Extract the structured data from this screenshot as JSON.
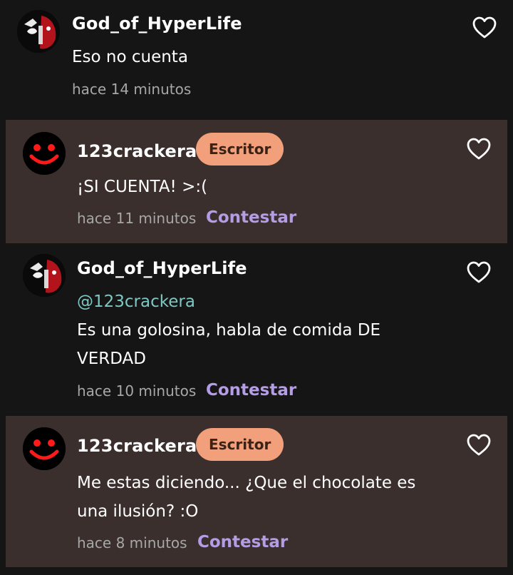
{
  "comments": [
    {
      "author": "God_of_HyperLife",
      "text": "Eso no cuenta",
      "time": "hace 14 minutos",
      "like_icon": "heart-outline-icon",
      "avatar_icon": "avatar-hyperlife"
    },
    {
      "author": "123crackera",
      "badge": "Escritor",
      "text": "¡SI CUENTA! >:(",
      "time": "hace 11 minutos",
      "reply_label": "Contestar",
      "like_icon": "heart-outline-icon",
      "avatar_icon": "avatar-red-smiley"
    },
    {
      "author": "God_of_HyperLife",
      "mention": "@123crackera",
      "text_line1": "Es una golosina, habla de comida DE",
      "text_line2": "VERDAD",
      "time": "hace 10 minutos",
      "reply_label": "Contestar",
      "like_icon": "heart-outline-icon",
      "avatar_icon": "avatar-hyperlife"
    },
    {
      "author": "123crackera",
      "badge": "Escritor",
      "text_line1": "Me estas diciendo... ¿Que el chocolate es",
      "text_line2": "una ilusión? :O",
      "time": "hace 8 minutos",
      "reply_label": "Contestar",
      "like_icon": "heart-outline-icon",
      "avatar_icon": "avatar-red-smiley"
    }
  ],
  "colors": {
    "background": "#151515",
    "reply_background": "#3a2f2c",
    "badge": "#f2a07b",
    "reply_link": "#b59de6",
    "mention": "#7ec8c4",
    "meta": "#a7a7a7"
  }
}
